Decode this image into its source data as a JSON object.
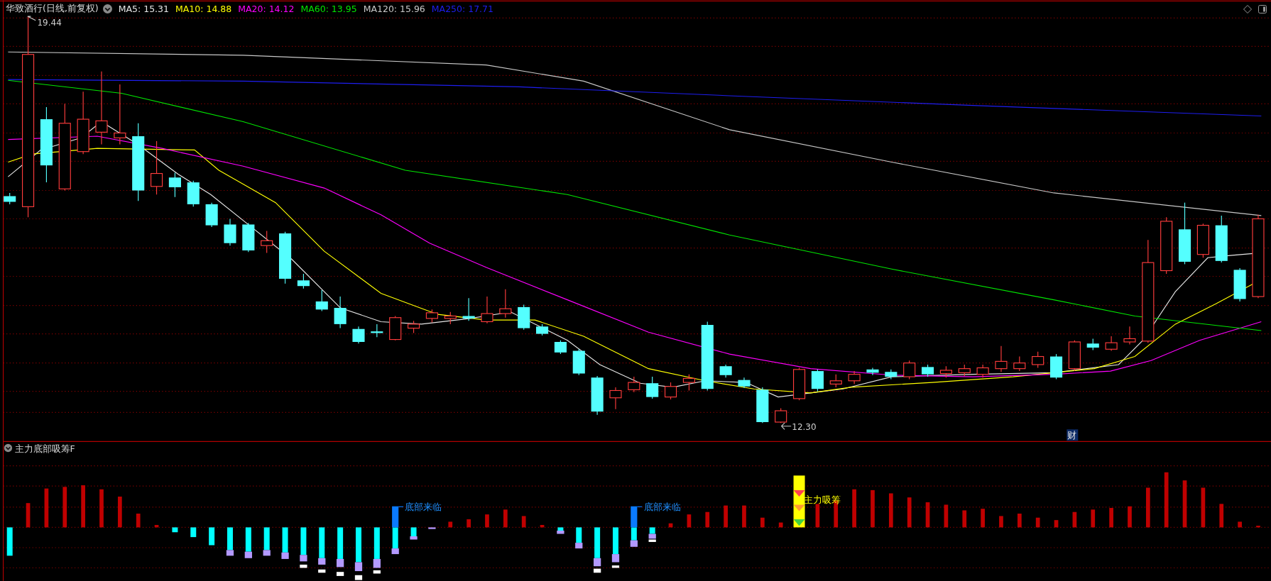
{
  "header": {
    "title": "华致酒行(日线,前复权)",
    "moving_averages": [
      {
        "label": "MA5: 15.31",
        "color": "#e6e6e6"
      },
      {
        "label": "MA10: 14.88",
        "color": "#ffff00"
      },
      {
        "label": "MA20: 14.12",
        "color": "#ff00ff"
      },
      {
        "label": "MA60: 13.95",
        "color": "#00e600"
      },
      {
        "label": "MA120: 15.96",
        "color": "#c8c8c8"
      },
      {
        "label": "MA250: 17.71",
        "color": "#1e1ef0"
      }
    ]
  },
  "price_chart": {
    "high_label": "19.44",
    "low_label": "12.30",
    "event_marker": "财"
  },
  "indicator_panel": {
    "title": "主力底部吸筹F",
    "signals": [
      {
        "kind": "bottom",
        "label": "底部来临"
      },
      {
        "kind": "bottom",
        "label": "底部来临"
      },
      {
        "kind": "accumulation",
        "label": "主力吸筹"
      }
    ]
  }
}
